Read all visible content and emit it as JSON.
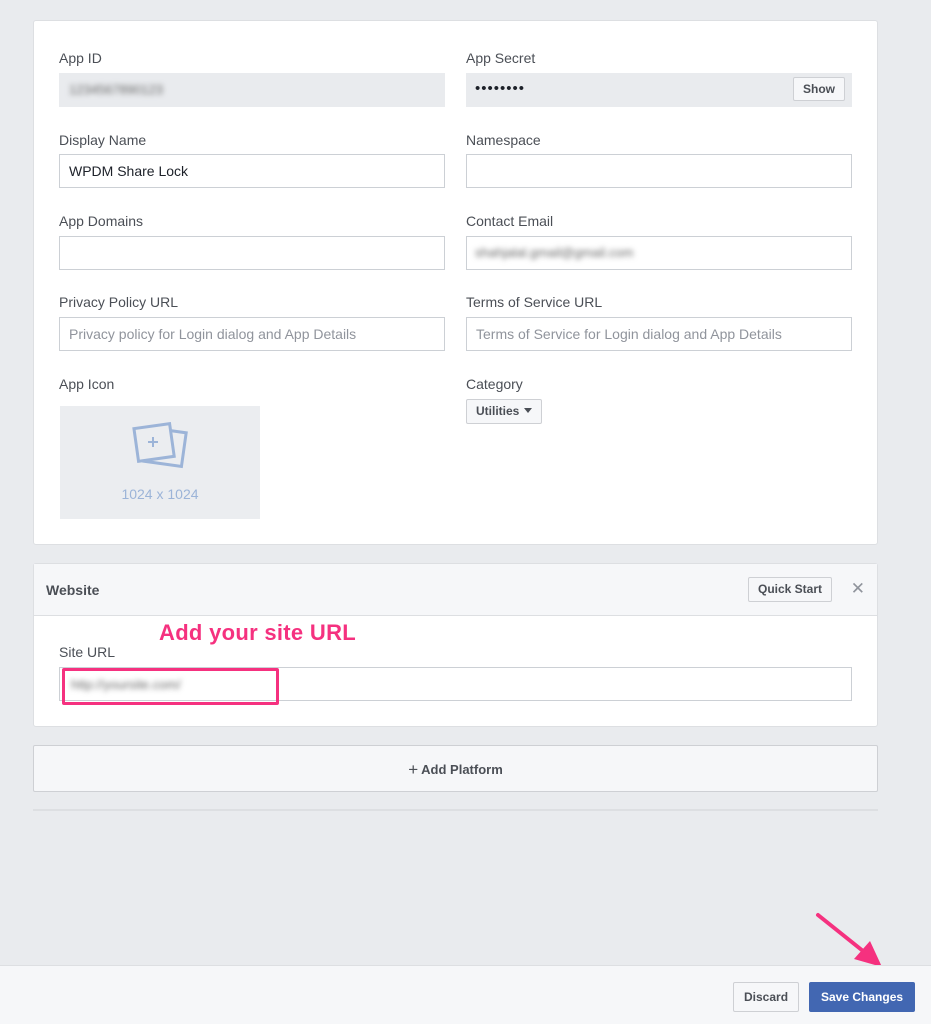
{
  "colors": {
    "accent": "#4267b2",
    "annotation": "#f5317f",
    "background": "#e9ebee"
  },
  "basic": {
    "app_id": {
      "label": "App ID",
      "value": "1234567890123"
    },
    "app_secret": {
      "label": "App Secret",
      "value": "••••••••",
      "show_label": "Show"
    },
    "display_name": {
      "label": "Display Name",
      "value": "WPDM Share Lock"
    },
    "namespace": {
      "label": "Namespace",
      "value": ""
    },
    "app_domains": {
      "label": "App Domains",
      "value": ""
    },
    "contact_email": {
      "label": "Contact Email",
      "value": "shahjalal.gmail@gmail.com"
    },
    "privacy_policy": {
      "label": "Privacy Policy URL",
      "placeholder": "Privacy policy for Login dialog and App Details"
    },
    "terms_of_service": {
      "label": "Terms of Service URL",
      "placeholder": "Terms of Service for Login dialog and App Details"
    },
    "app_icon": {
      "label": "App Icon",
      "size_text": "1024 x 1024",
      "icon": "image-add-icon"
    },
    "category": {
      "label": "Category",
      "selected": "Utilities"
    }
  },
  "website": {
    "title": "Website",
    "quick_start_label": "Quick Start",
    "close_icon": "close-icon",
    "site_url": {
      "label": "Site URL",
      "value": "http://yoursite.com/"
    },
    "annotation": "Add your site URL"
  },
  "add_platform": {
    "label": "Add Platform",
    "icon": "plus-icon"
  },
  "footer": {
    "discard_label": "Discard",
    "save_label": "Save Changes"
  }
}
